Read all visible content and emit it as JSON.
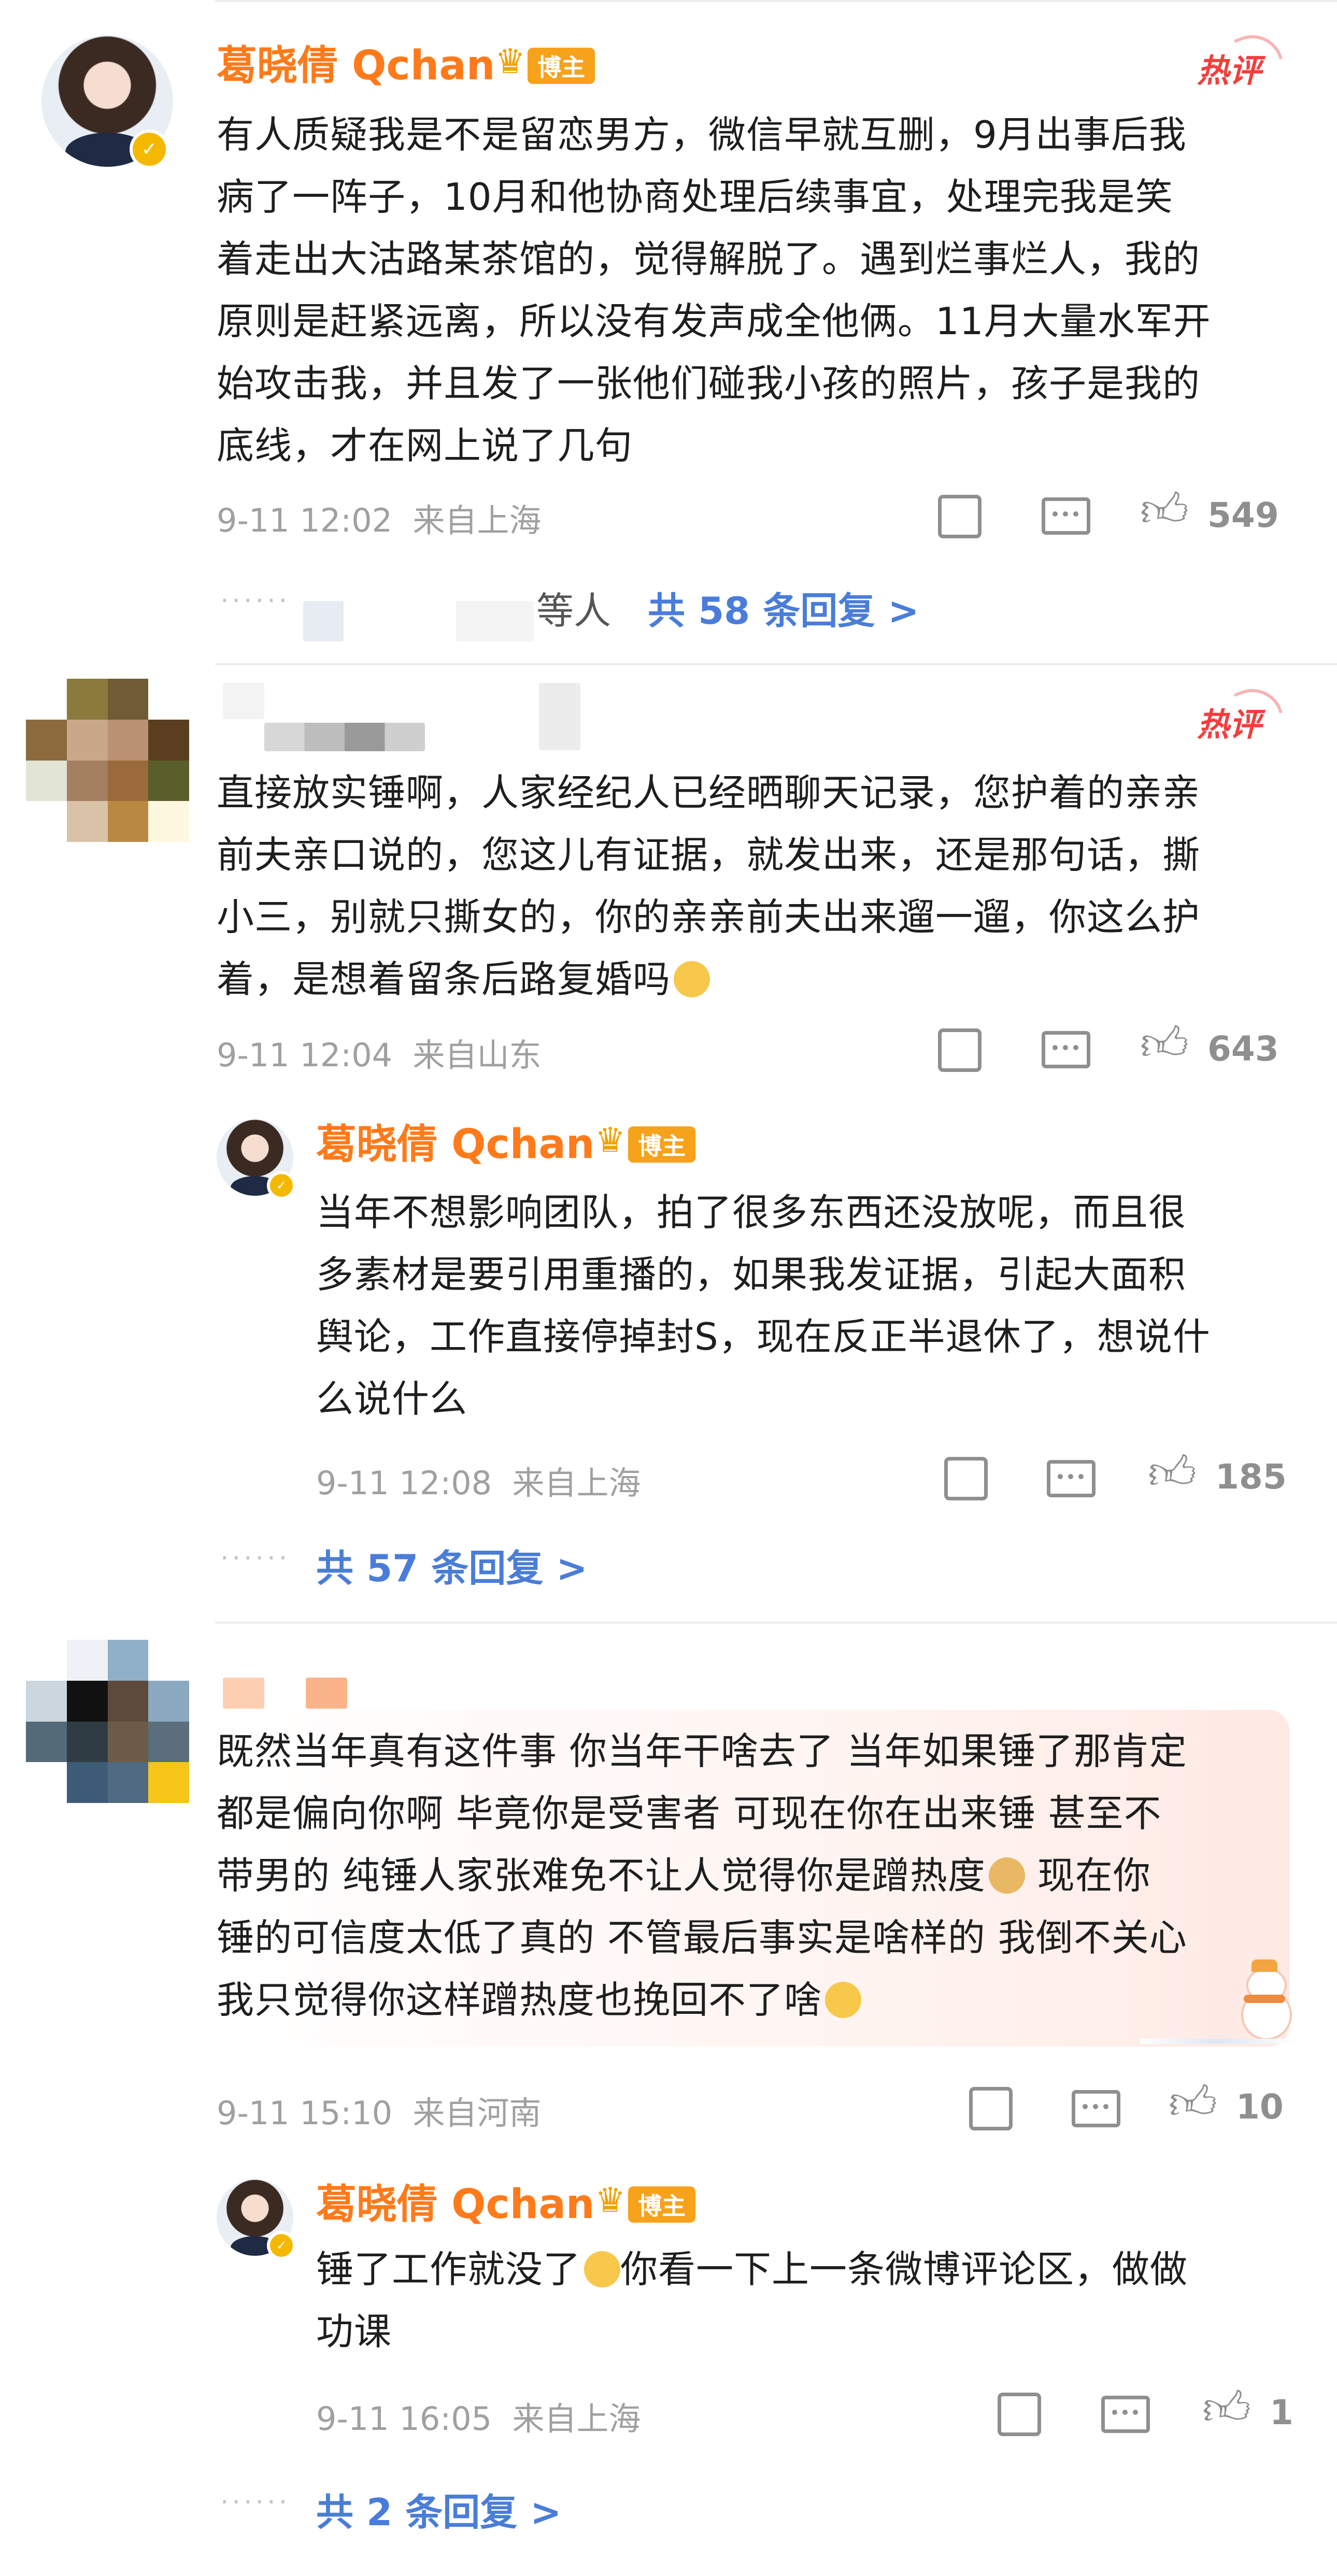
{
  "colors": {
    "username": "#ff7a1a",
    "link": "#4a7dd9",
    "meta": "#a0a0a0",
    "hot": "#f33e3e",
    "badge": "#f7a21b"
  },
  "comments": [
    {
      "username": "葛晓倩 Qchan",
      "badge": "博主",
      "hot_label": "热评",
      "lines": [
        "有人质疑我是不是留恋男方，微信早就互删，9月出事后我",
        "病了一阵子，10月和他协商处理后续事宜，处理完我是笑",
        "着走出大沽路某茶馆的，觉得解脱了。遇到烂事烂人，我的",
        "原则是赶紧远离，所以没有发声成全他俩。11月大量水军开",
        "始攻击我，并且发了一张他们碰我小孩的照片，孩子是我的",
        "底线，才在网上说了几句"
      ],
      "time": "9-11 12:02",
      "location": "来自上海",
      "likes": "549",
      "replies_prefix": "等人",
      "replies_link": "共 58 条回复 >"
    },
    {
      "hot_label": "热评",
      "lines": [
        "直接放实锤啊，人家经纪人已经晒聊天记录，您护着的亲亲",
        "前夫亲口说的，您这儿有证据，就发出来，还是那句话，撕",
        "小三，别就只撕女的，你的亲亲前夫出来遛一遛，你这么护",
        "着，是想着留条后路复婚吗"
      ],
      "time": "9-11 12:04",
      "location": "来自山东",
      "likes": "643",
      "reply": {
        "username": "葛晓倩 Qchan",
        "badge": "博主",
        "lines": [
          "当年不想影响团队，拍了很多东西还没放呢，而且很",
          "多素材是要引用重播的，如果我发证据，引起大面积",
          "舆论，工作直接停掉封S，现在反正半退休了，想说什",
          "么说什么"
        ],
        "time": "9-11 12:08",
        "location": "来自上海",
        "likes": "185"
      },
      "replies_link": "共 57 条回复 >"
    },
    {
      "lines": [
        "既然当年真有这件事 你当年干啥去了 当年如果锤了那肯定",
        "都是偏向你啊 毕竟你是受害者 可现在你在出来锤 甚至不",
        "带男的 纯锤人家张难免不让人觉得你是蹭热度",
        "锤的可信度太低了真的 不管最后事实是啥样的 我倒不关心",
        "我只觉得你这样蹭热度也挽回不了啥"
      ],
      "line3_tail": " 现在你",
      "time": "9-11 15:10",
      "location": "来自河南",
      "likes": "10",
      "reply": {
        "username": "葛晓倩 Qchan",
        "badge": "博主",
        "line1": "锤了工作就没了",
        "line1_tail": "你看一下上一条微博评论区，做做",
        "line2": "功课",
        "time": "9-11 16:05",
        "location": "来自上海",
        "likes": "1"
      },
      "replies_link": "共 2 条回复 >"
    }
  ],
  "icons": [
    "share-icon",
    "comment-icon",
    "like-icon",
    "crown-icon",
    "verified-icon"
  ]
}
